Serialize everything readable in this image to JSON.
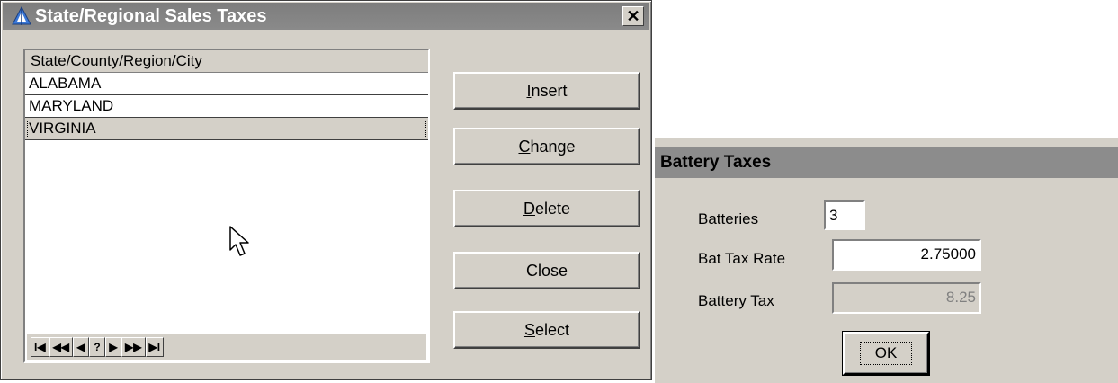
{
  "dialog": {
    "title": "State/Regional Sales Taxes",
    "close_label": "✕",
    "list_header": "State/County/Region/City",
    "rows": [
      "ALABAMA",
      "MARYLAND",
      "VIRGINIA"
    ],
    "selected_row": "VIRGINIA",
    "nav_buttons": [
      "I◀",
      "◀◀",
      "◀",
      "?",
      "▶",
      "▶▶",
      "▶I"
    ],
    "buttons": {
      "insert": {
        "key": "I",
        "rest": "nsert"
      },
      "change": {
        "key": "C",
        "rest": "hange"
      },
      "delete": {
        "key": "D",
        "rest": "elete"
      },
      "close": {
        "key": "",
        "rest": "Close"
      },
      "select": {
        "key": "S",
        "rest": "elect"
      }
    }
  },
  "battery": {
    "title": "Battery Taxes",
    "batteries_label": "Batteries",
    "batteries_value": "3",
    "rate_label": "Bat Tax Rate",
    "rate_value": "2.75000",
    "tax_label": "Battery Tax",
    "tax_value": "8.25",
    "ok_label": "OK"
  }
}
